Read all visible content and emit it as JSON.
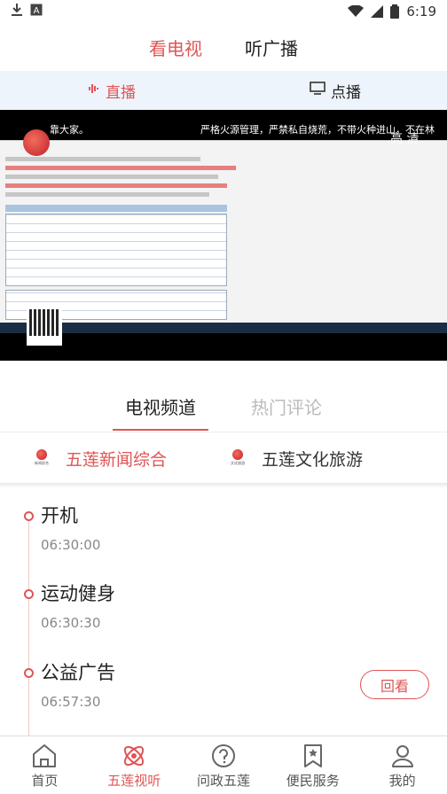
{
  "status_bar": {
    "time": "6:19"
  },
  "top_tabs": [
    {
      "label": "看电视",
      "active": true
    },
    {
      "label": "听广播",
      "active": false
    }
  ],
  "sub_tabs": [
    {
      "label": "直播",
      "icon": "live-wave-icon",
      "active": true
    },
    {
      "label": "点播",
      "icon": "monitor-icon",
      "active": false
    }
  ],
  "video": {
    "ticker_left": "靠大家。",
    "ticker_right": "严格火源管理，严禁私自烧荒，不带火种进山，不在林",
    "quality": "高 清"
  },
  "channel_tabs": [
    {
      "label": "电视频道",
      "active": true
    },
    {
      "label": "热门评论",
      "active": false
    }
  ],
  "channels": [
    {
      "name": "五莲新闻综合",
      "logo_text": "新闻综合",
      "active": true
    },
    {
      "name": "五莲文化旅游",
      "logo_text": "文化旅游",
      "active": false
    }
  ],
  "schedule": [
    {
      "title": "开机",
      "time": "06:30:00"
    },
    {
      "title": "运动健身",
      "time": "06:30:30"
    },
    {
      "title": "公益广告",
      "time": "06:57:30"
    }
  ],
  "replay_label": "回看",
  "bottom_nav": [
    {
      "label": "首页",
      "icon": "home-icon",
      "active": false
    },
    {
      "label": "五莲视听",
      "icon": "atom-icon",
      "active": true
    },
    {
      "label": "问政五莲",
      "icon": "question-icon",
      "active": false
    },
    {
      "label": "便民服务",
      "icon": "bookmark-star-icon",
      "active": false
    },
    {
      "label": "我的",
      "icon": "user-icon",
      "active": false
    }
  ],
  "colors": {
    "accent": "#e05555",
    "subtab_bg": "#eef4fb"
  }
}
